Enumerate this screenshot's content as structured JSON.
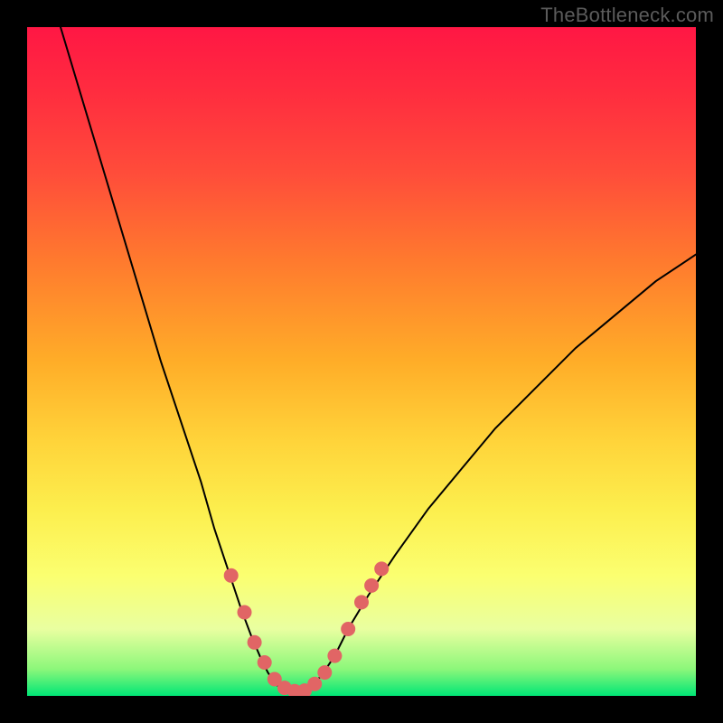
{
  "watermark": "TheBottleneck.com",
  "chart_data": {
    "type": "line",
    "title": "",
    "xlabel": "",
    "ylabel": "",
    "xlim": [
      0,
      100
    ],
    "ylim": [
      0,
      100
    ],
    "grid": false,
    "legend": false,
    "annotations": [],
    "series": [
      {
        "name": "left-branch",
        "x": [
          5,
          8,
          11,
          14,
          17,
          20,
          23,
          26,
          28,
          30,
          32,
          33.5,
          35,
          36,
          37,
          38
        ],
        "y": [
          100,
          90,
          80,
          70,
          60,
          50,
          41,
          32,
          25,
          19,
          13,
          9,
          5.5,
          3.5,
          2,
          1
        ]
      },
      {
        "name": "trough",
        "x": [
          38,
          39,
          40,
          41,
          42
        ],
        "y": [
          1,
          0.6,
          0.5,
          0.6,
          1
        ]
      },
      {
        "name": "right-branch",
        "x": [
          42,
          44,
          46,
          48,
          51,
          55,
          60,
          65,
          70,
          76,
          82,
          88,
          94,
          100
        ],
        "y": [
          1,
          3,
          6,
          10,
          15,
          21,
          28,
          34,
          40,
          46,
          52,
          57,
          62,
          66
        ]
      }
    ],
    "markers": {
      "name": "highlighted-points",
      "color": "#e16565",
      "points": [
        {
          "x": 30.5,
          "y": 18
        },
        {
          "x": 32.5,
          "y": 12.5
        },
        {
          "x": 34,
          "y": 8
        },
        {
          "x": 35.5,
          "y": 5
        },
        {
          "x": 37,
          "y": 2.5
        },
        {
          "x": 38.5,
          "y": 1.2
        },
        {
          "x": 40,
          "y": 0.7
        },
        {
          "x": 41.5,
          "y": 0.8
        },
        {
          "x": 43,
          "y": 1.8
        },
        {
          "x": 44.5,
          "y": 3.5
        },
        {
          "x": 46,
          "y": 6
        },
        {
          "x": 48,
          "y": 10
        },
        {
          "x": 50,
          "y": 14
        },
        {
          "x": 51.5,
          "y": 16.5
        },
        {
          "x": 53,
          "y": 19
        }
      ]
    }
  }
}
